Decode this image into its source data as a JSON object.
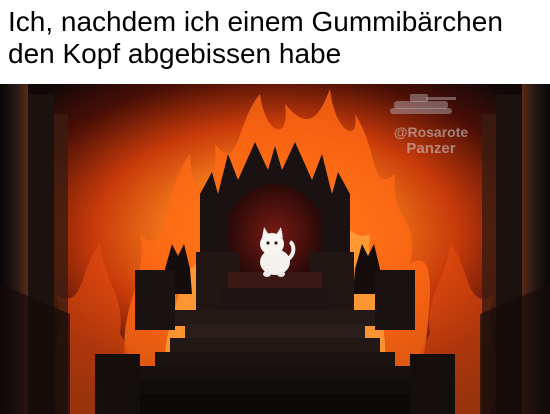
{
  "caption": {
    "line1": "Ich, nachdem ich einem Gummibärchen",
    "line2": "den Kopf abgebissen habe"
  },
  "watermark": {
    "line1": "@Rosarote",
    "line2": "Panzer",
    "icon": "tank-icon"
  },
  "scene": {
    "subject": "white-kitten",
    "setting": "throne-in-flames",
    "colors": {
      "fire": "#ff7a1a",
      "fire_core": "#ffd36a",
      "stone": "#1a1414",
      "background": "#0f0b0b"
    }
  }
}
